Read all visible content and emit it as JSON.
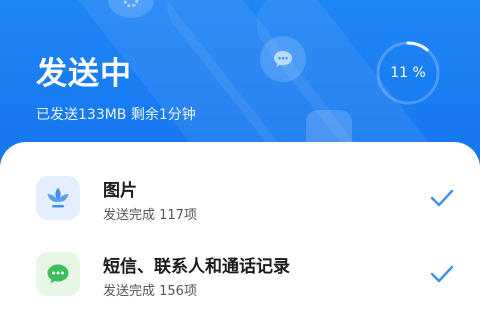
{
  "header": {
    "title": "发送中",
    "subtitle": "已发送133MB 剩余1分钟",
    "progress_label": "11 %",
    "progress_fraction": 0.11
  },
  "colors": {
    "background": "#1a7df5",
    "accent": "#1f86f7",
    "check": "#3f8ef4",
    "photo_icon_bg": "#e3effd",
    "sms_icon_bg": "#e6f7e6",
    "sms_icon": "#3cbf5a"
  },
  "items": [
    {
      "name": "图片",
      "status": "发送完成 117项",
      "icon": "photo-flower-icon"
    },
    {
      "name": "短信、联系人和通话记录",
      "status": "发送完成 156项",
      "icon": "message-bubble-icon"
    }
  ]
}
